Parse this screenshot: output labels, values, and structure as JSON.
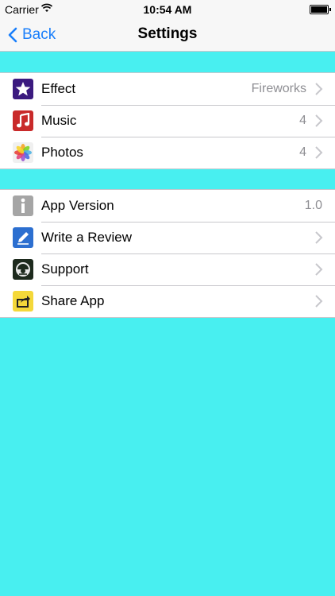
{
  "status": {
    "carrier": "Carrier",
    "time": "10:54 AM"
  },
  "nav": {
    "back_label": "Back",
    "title": "Settings"
  },
  "group1": [
    {
      "label": "Effect",
      "value": "Fireworks",
      "icon": "star-icon"
    },
    {
      "label": "Music",
      "value": "4",
      "icon": "music-note-icon"
    },
    {
      "label": "Photos",
      "value": "4",
      "icon": "photos-flower-icon"
    }
  ],
  "group2": [
    {
      "label": "App Version",
      "value": "1.0",
      "icon": "info-icon"
    },
    {
      "label": "Write a Review",
      "value": "",
      "icon": "pencil-icon"
    },
    {
      "label": "Support",
      "value": "",
      "icon": "support-icon"
    },
    {
      "label": "Share App",
      "value": "",
      "icon": "share-icon"
    }
  ],
  "colors": {
    "background": "#48eff0",
    "accent": "#1a7ffb"
  }
}
